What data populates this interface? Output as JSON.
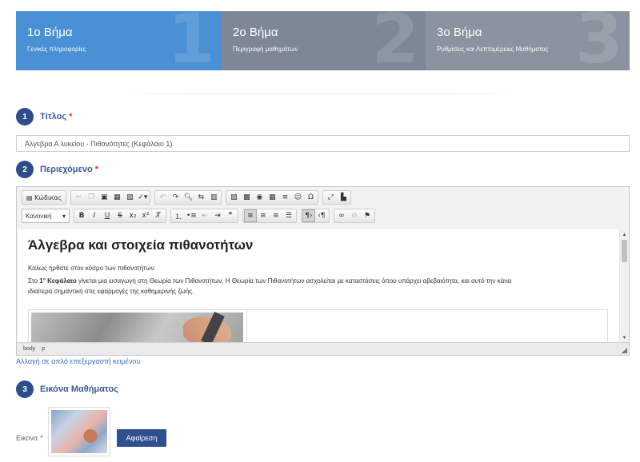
{
  "wizard": {
    "steps": [
      {
        "title": "1ο Βήμα",
        "subtitle": "Γενικές πληροφορίες",
        "number": "1"
      },
      {
        "title": "2ο Βήμα",
        "subtitle": "Περιγραφή μαθημάτων",
        "number": "2"
      },
      {
        "title": "3ο Βήμα",
        "subtitle": "Ρυθμίσεις και Λεπτομέρειες Μαθήματος",
        "number": "3"
      }
    ],
    "active_index": 0
  },
  "sections": {
    "title": {
      "num": "1",
      "label": "Τίτλος",
      "required": "*"
    },
    "content": {
      "num": "2",
      "label": "Περιεχόμενο",
      "required": "*"
    },
    "image": {
      "num": "3",
      "label": "Εικόνα Μαθήματος"
    }
  },
  "title_input": {
    "value": "Άλγεβρα Α λυκείου - Πιθανότητες (Κεφάλαιο 1)"
  },
  "editor": {
    "toolbar_row1": {
      "source_label": "Κώδικας",
      "icons": [
        "cut-icon",
        "copy-icon",
        "paste-icon",
        "paste-text-icon",
        "paste-word-icon",
        "spellcheck-icon",
        "undo-icon",
        "redo-icon",
        "find-icon",
        "replace-icon",
        "select-all-icon",
        "image-icon",
        "flash-icon",
        "link-icon",
        "table-icon",
        "horizontal-rule-icon",
        "smiley-icon",
        "special-char-icon",
        "maximize-icon",
        "show-blocks-icon"
      ]
    },
    "toolbar_row2": {
      "format_value": "Κανονική",
      "icons": [
        "bold-icon",
        "italic-icon",
        "underline-icon",
        "strike-icon",
        "subscript-icon",
        "superscript-icon",
        "remove-format-icon",
        "numbered-list-icon",
        "bulleted-list-icon",
        "outdent-icon",
        "indent-icon",
        "blockquote-icon",
        "align-left-icon",
        "align-center-icon",
        "align-right-icon",
        "justify-icon",
        "ltr-icon",
        "rtl-icon",
        "anchor-link-icon",
        "unlink-icon",
        "flag-icon"
      ]
    },
    "content": {
      "heading": "Άλγεβρα και στοιχεία πιθανοτήτων",
      "line1": "Καλως ήρθατε στον κόσμο των πιθανοτήτων.",
      "line2_prefix": "Στο ",
      "line2_bold": "1° Κεφάλαιο",
      "line2_rest": " γίνεται μια εισαγωγή στη Θεωρία των Πιθανοτήτων. Η Θεωρία των Πιθανοτήτων ασχολείται με καταστάσεις όπου υπάρχει αβεβαιότητα, και αυτό την κάνει",
      "line3": "ιδιαίτερα σημαντική στις εφαρμογές της καθημερινής ζωής."
    },
    "status_path": [
      "body",
      "p"
    ]
  },
  "plain_editor_link": "Αλλαγή σε απλό επεξεργαστή κειμένου",
  "course_image": {
    "label": "Εικονα",
    "required": "*",
    "remove_button": "Αφαίρεση"
  },
  "colors": {
    "active_step": "#4a90d4",
    "inactive_step": "#7d8796",
    "badge": "#2e4d8b",
    "required": "#e0352b"
  }
}
